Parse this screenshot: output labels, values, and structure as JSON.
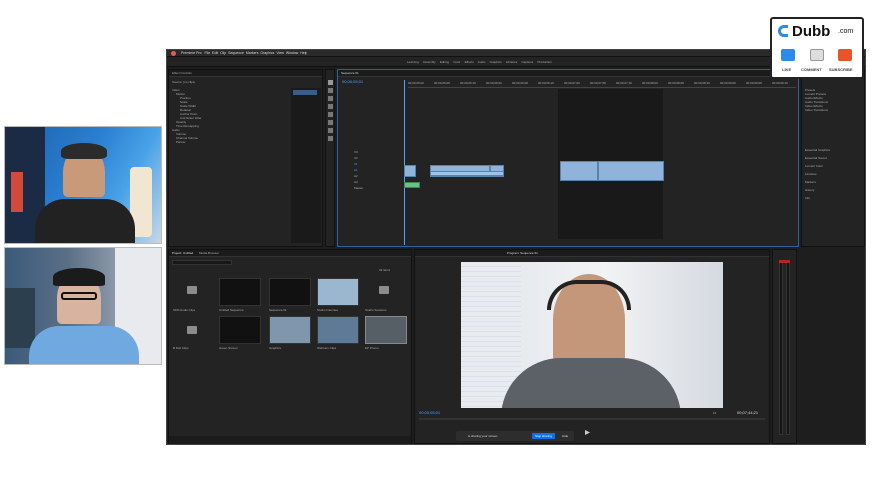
{
  "app": {
    "name": "Premiere Pro",
    "menu": [
      "Premiere Pro",
      "File",
      "Edit",
      "Clip",
      "Sequence",
      "Markers",
      "Graphics",
      "View",
      "Window",
      "Help"
    ]
  },
  "workspaces": [
    "Learning",
    "Assembly",
    "Editing",
    "Color",
    "Effects",
    "Audio",
    "Graphics",
    "Libraries",
    "Captions",
    "Production"
  ],
  "effect_controls": {
    "tab_label": "Effect Controls",
    "source_label": "Source: (no clips)",
    "params": [
      "Video",
      "Motion",
      "Position",
      "Scale",
      "Scale Width",
      "Rotation",
      "Anchor Point",
      "Anti-flicker Filter",
      "Opacity",
      "Time Remapping",
      "Audio",
      "Volume",
      "Channel Volume",
      "Panner"
    ]
  },
  "sequence": {
    "tab_label": "Sequence 01",
    "timecode": "00;00;05;01",
    "ruler": [
      "00;00;05;00",
      "00;00;05;08",
      "00;00;05;16",
      "00;00;06;00",
      "00;00;06;08",
      "00;00;06;16",
      "00;00;07;00",
      "00;00;07;08",
      "00;00;07;16",
      "00;00;08;00",
      "00;00;08;08",
      "00;00;08;16",
      "00;00;09;00",
      "00;00;09;08",
      "00;00;09;16"
    ],
    "tracks": [
      "V3",
      "V2",
      "V1",
      "A1",
      "A2",
      "A3",
      "Master"
    ]
  },
  "project": {
    "tab_label": "Project: Untitled",
    "tab2_label": "Media Browser",
    "item_count": "32 items",
    "items": [
      "SMS Audio Clips",
      "Untitled Sequence",
      "Sequence 01",
      "Studio Interview",
      "Studio Sessions",
      "B Roll Clips",
      "Green Screen",
      "Graphics",
      "Webcam Clips",
      "EP Promo"
    ]
  },
  "program": {
    "tab_label": "Program: Sequence 01",
    "timecode_left": "00;00;05;01",
    "fit": "Fit",
    "timecode_right": "00;07;44;21"
  },
  "effects_panel": {
    "items": [
      "Presets",
      "Lumetri Presets",
      "Audio Effects",
      "Audio Transitions",
      "Video Effects",
      "Video Transitions"
    ],
    "sections": [
      "Essential Graphics",
      "Essential Sound",
      "Lumetri Color",
      "Libraries",
      "Markers",
      "History",
      "Info"
    ]
  },
  "share_bar": {
    "text": "is sharing your screen.",
    "stop_label": "Stop sharing",
    "hide_label": "Hide"
  },
  "dubb": {
    "brand": "Dubb",
    "suffix": ".com",
    "like": "LIKE",
    "comment": "COMMENT",
    "subscribe": "SUBSCRIBE",
    "like_color": "#2b8be6",
    "subscribe_color": "#e8532b"
  }
}
